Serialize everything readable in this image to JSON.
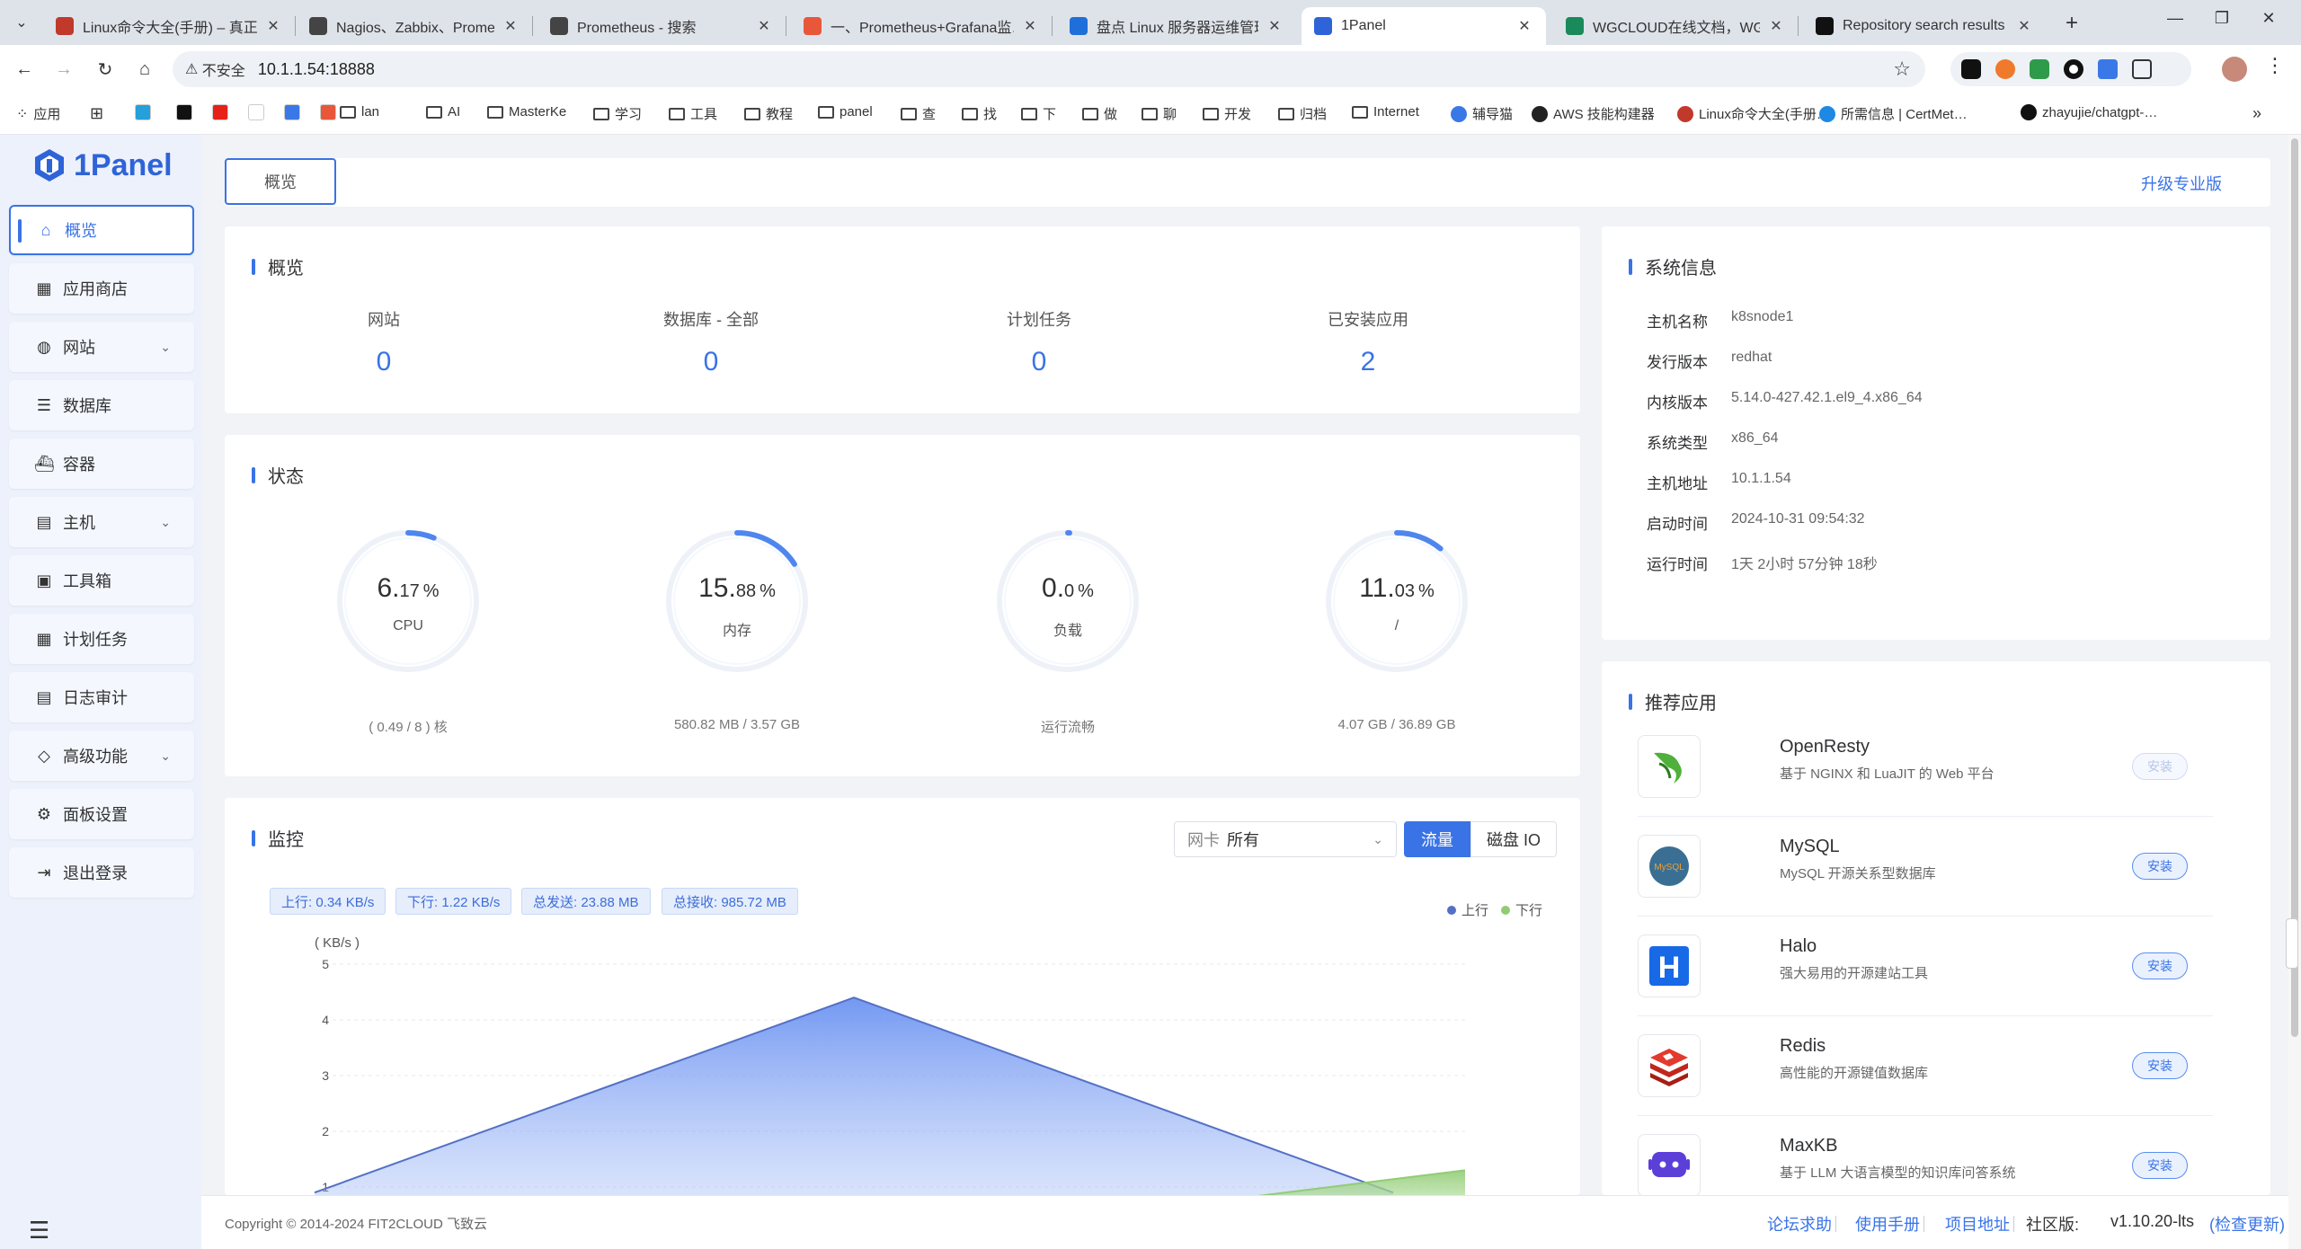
{
  "browser": {
    "tabs": [
      {
        "title": "Linux命令大全(手册) – 真正好用…",
        "fav_color": "#c0392b"
      },
      {
        "title": "Nagios、Zabbix、Prometheus…",
        "fav_color": "#444444"
      },
      {
        "title": "Prometheus - 搜索",
        "fav_color": "#444444"
      },
      {
        "title": "一、Prometheus+Grafana监…",
        "fav_color": "#e8573a"
      },
      {
        "title": "盘点 Linux 服务器运维管理面…",
        "fav_color": "#1e6fd9"
      },
      {
        "title": "1Panel",
        "fav_color": "#2f63d8"
      },
      {
        "title": "WGCLOUD在线文档，WGCLOU…",
        "fav_color": "#1a8a5a"
      },
      {
        "title": "Repository search results",
        "fav_color": "#111111"
      }
    ],
    "address": {
      "security_label": "不安全",
      "url": "10.1.1.54:18888"
    },
    "bookmarks": [
      "应用",
      "lan",
      "AI",
      "MasterKe",
      "学习",
      "工具",
      "教程",
      "panel",
      "查",
      "找",
      "下",
      "做",
      "聊",
      "开发",
      "归档",
      "Internet",
      "辅导猫",
      "AWS 技能构建器",
      "Linux命令大全(手册…",
      "所需信息 | CertMet…",
      "zhayujie/chatgpt-…"
    ]
  },
  "sidebar": {
    "logo": "1Panel",
    "items": [
      {
        "label": "概览",
        "icon": "home-icon",
        "has_chevron": false
      },
      {
        "label": "应用商店",
        "icon": "grid-icon",
        "has_chevron": false
      },
      {
        "label": "网站",
        "icon": "globe-icon",
        "has_chevron": true
      },
      {
        "label": "数据库",
        "icon": "database-icon",
        "has_chevron": false
      },
      {
        "label": "容器",
        "icon": "docker-icon",
        "has_chevron": false
      },
      {
        "label": "主机",
        "icon": "server-icon",
        "has_chevron": true
      },
      {
        "label": "工具箱",
        "icon": "toolbox-icon",
        "has_chevron": false
      },
      {
        "label": "计划任务",
        "icon": "calendar-icon",
        "has_chevron": false
      },
      {
        "label": "日志审计",
        "icon": "log-icon",
        "has_chevron": false
      },
      {
        "label": "高级功能",
        "icon": "diamond-icon",
        "has_chevron": true
      },
      {
        "label": "面板设置",
        "icon": "gear-icon",
        "has_chevron": false
      },
      {
        "label": "退出登录",
        "icon": "logout-icon",
        "has_chevron": false
      }
    ]
  },
  "topbar": {
    "tab": "概览",
    "upgrade": "升级专业版"
  },
  "overview": {
    "title": "概览",
    "items": [
      {
        "label": "网站",
        "value": "0"
      },
      {
        "label": "数据库 - 全部",
        "value": "0"
      },
      {
        "label": "计划任务",
        "value": "0"
      },
      {
        "label": "已安装应用",
        "value": "2"
      }
    ]
  },
  "status": {
    "title": "状态",
    "gauges": [
      {
        "int": "6.",
        "dec": "17",
        "unit": "%",
        "name": "CPU",
        "sub": "( 0.49 / 8 ) 核",
        "percent": 6.17
      },
      {
        "int": "15.",
        "dec": "88",
        "unit": "%",
        "name": "内存",
        "sub": "580.82 MB / 3.57 GB",
        "percent": 15.88
      },
      {
        "int": "0.",
        "dec": "0",
        "unit": "%",
        "name": "负载",
        "sub": "运行流畅",
        "percent": 0
      },
      {
        "int": "11.",
        "dec": "03",
        "unit": "%",
        "name": "/",
        "sub": "4.07 GB / 36.89 GB",
        "percent": 11.03
      }
    ]
  },
  "monitor": {
    "title": "监控",
    "nic_label": "网卡",
    "nic_value": "所有",
    "btn_traffic": "流量",
    "btn_disk": "磁盘 IO",
    "tags": [
      "上行: 0.34 KB/s",
      "下行: 1.22 KB/s",
      "总发送: 23.88 MB",
      "总接收: 985.72 MB"
    ],
    "legend_up": "上行",
    "legend_down": "下行"
  },
  "chart_data": {
    "type": "area",
    "ylabel": "( KB/s )",
    "ylim": [
      0,
      5
    ],
    "yticks": [
      1,
      2,
      3,
      4,
      5
    ],
    "x": [
      0,
      1,
      2
    ],
    "series": [
      {
        "name": "上行",
        "values": [
          0.9,
          4.4,
          0.9
        ],
        "color": "#5470c6"
      },
      {
        "name": "下行",
        "values": [
          0.5,
          0.8,
          1.3
        ],
        "color": "#91cc75"
      }
    ],
    "grid": true,
    "legend": "top-right"
  },
  "sysinfo": {
    "title": "系统信息",
    "rows": [
      {
        "k": "主机名称",
        "v": "k8snode1"
      },
      {
        "k": "发行版本",
        "v": "redhat"
      },
      {
        "k": "内核版本",
        "v": "5.14.0-427.42.1.el9_4.x86_64"
      },
      {
        "k": "系统类型",
        "v": "x86_64"
      },
      {
        "k": "主机地址",
        "v": "10.1.1.54"
      },
      {
        "k": "启动时间",
        "v": "2024-10-31 09:54:32"
      },
      {
        "k": "运行时间",
        "v": "1天 2小时 57分钟 18秒"
      }
    ]
  },
  "apps": {
    "title": "推荐应用",
    "items": [
      {
        "name": "OpenResty",
        "desc": "基于 NGINX 和 LuaJIT 的 Web 平台",
        "btn": "安装",
        "disabled": true
      },
      {
        "name": "MySQL",
        "desc": "MySQL 开源关系型数据库",
        "btn": "安装",
        "disabled": false
      },
      {
        "name": "Halo",
        "desc": "强大易用的开源建站工具",
        "btn": "安装",
        "disabled": false
      },
      {
        "name": "Redis",
        "desc": "高性能的开源键值数据库",
        "btn": "安装",
        "disabled": false
      },
      {
        "name": "MaxKB",
        "desc": "基于 LLM 大语言模型的知识库问答系统",
        "btn": "安装",
        "disabled": false
      }
    ]
  },
  "footer": {
    "copyright": "Copyright © 2014-2024 FIT2CLOUD 飞致云",
    "links": [
      "论坛求助",
      "使用手册",
      "项目地址"
    ],
    "edition": "社区版:",
    "version": "v1.10.20-lts",
    "check_update": "(检查更新)"
  }
}
